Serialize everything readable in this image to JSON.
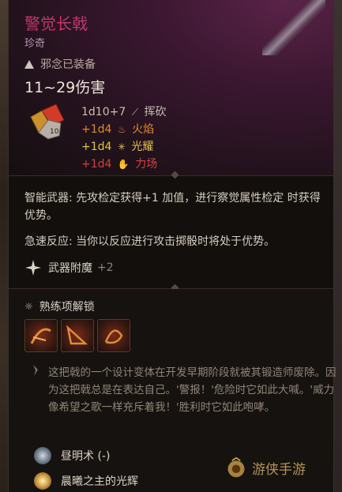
{
  "item": {
    "title": "警觉长戟",
    "rarity": "珍奇",
    "equip_status": "邪念已装备",
    "damage": "11~29伤害"
  },
  "damage_lines": [
    {
      "dice": "1d10+7",
      "icon": "slash-icon",
      "type": "挥砍",
      "color": "#c7bdb1"
    },
    {
      "dice": "+1d4",
      "icon": "fire-icon",
      "type": "火焰",
      "color": "#e2872e"
    },
    {
      "dice": "+1d4",
      "icon": "radiant-icon",
      "type": "光耀",
      "color": "#e1c24a"
    },
    {
      "dice": "+1d4",
      "icon": "force-icon",
      "type": "力场",
      "color": "#d64040"
    }
  ],
  "dice_badge": "10",
  "properties": {
    "p1_label": "智能武器:",
    "p1_text": "先攻检定获得+1 加值，进行察觉属性检定 时获得 优势。",
    "p2_label": "急速反应:",
    "p2_text": "当你以反应进行攻击掷骰时将处于优势。"
  },
  "enchant": {
    "label": "武器附魔",
    "bonus": "+2"
  },
  "proficiency": {
    "label": "熟练项解锁",
    "skills": [
      "skill-1-icon",
      "skill-2-icon",
      "skill-3-icon"
    ]
  },
  "lore": "这把戟的一个设计变体在开发早期阶段就被其锻造师废除。因为这把戟总是在表达自己。'警报！'危险时它如此大喊。'威力像希望之歌一样充斥着我！'胜利时它如此咆哮。",
  "spells": [
    {
      "label": "昼明术 (-)",
      "icon": "daylight-icon"
    },
    {
      "label": "晨曦之主的光辉",
      "icon": "sunburst-icon"
    }
  ],
  "watermark": "游侠手游",
  "colors": {
    "title": "#c4366c",
    "fire": "#e2872e",
    "radiant": "#e1c24a",
    "force": "#d64040"
  }
}
